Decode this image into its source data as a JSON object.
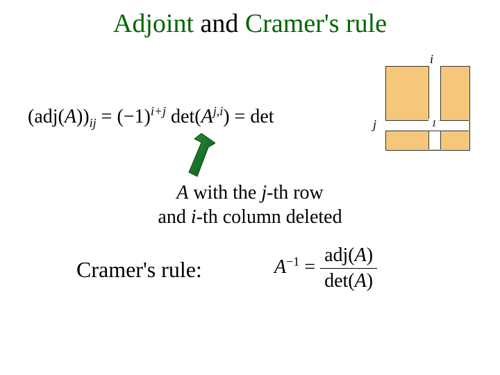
{
  "title": {
    "pre": "Adjoint ",
    "and": "and",
    "post": " Cramer's rule"
  },
  "eq1": {
    "lhs_pre": "(adj(",
    "lhs_A": "A",
    "lhs_post": "))",
    "lhs_sub": "ij",
    "eq": " = ",
    "sign_base": "(−1)",
    "sign_exp": "i+j",
    "det1_pre": " det(",
    "det1_A": "A",
    "det1_sup": "j,i",
    "det1_post": ")",
    "eq2": " = ",
    "det2": "det"
  },
  "matrix": {
    "i": "i",
    "j": "j",
    "one": "1"
  },
  "caption": {
    "line1_pre": "",
    "A": "A",
    "line1_mid": " with the ",
    "j": "j",
    "line1_post": "-th row",
    "line2_pre": "and ",
    "i": "i",
    "line2_post": "-th column deleted"
  },
  "cramer": {
    "label": "Cramer's rule:"
  },
  "eq2block": {
    "A": "A",
    "inv": "−1",
    "eq": " = ",
    "num_pre": "adj(",
    "num_A": "A",
    "num_post": ")",
    "den_pre": "det(",
    "den_A": "A",
    "den_post": ")"
  }
}
